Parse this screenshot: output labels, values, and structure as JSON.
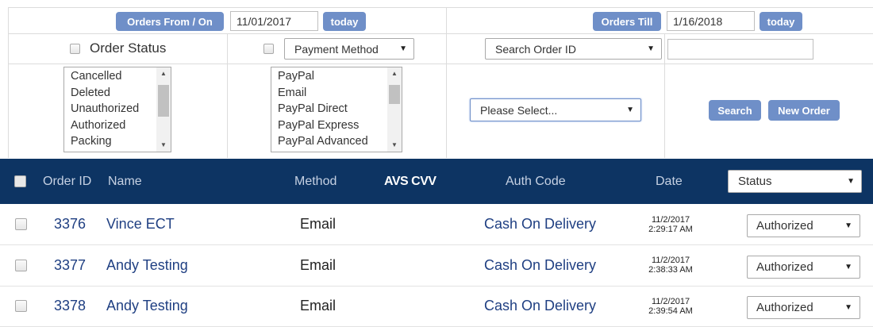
{
  "filters": {
    "orders_from_label": "Orders From / On",
    "from_date": "11/01/2017",
    "today_label": "today",
    "orders_till_label": "Orders Till",
    "till_date": "1/16/2018",
    "order_status_label": "Order Status",
    "payment_method_select": "Payment Method",
    "search_order_select": "Search Order ID",
    "search_order_value": "",
    "status_list": [
      "Cancelled",
      "Deleted",
      "Unauthorized",
      "Authorized",
      "Packing"
    ],
    "payment_list": [
      "PayPal",
      "Email",
      "PayPal Direct",
      "PayPal Express",
      "PayPal Advanced"
    ],
    "please_select": "Please Select...",
    "search_button": "Search",
    "new_order_button": "New Order"
  },
  "table": {
    "headers": {
      "order_id": "Order ID",
      "name": "Name",
      "method": "Method",
      "avs_cvv": "AVS CVV",
      "auth_code": "Auth Code",
      "date": "Date",
      "status_select": "Status"
    },
    "rows": [
      {
        "id": "3376",
        "name": "Vince ECT",
        "method": "Email",
        "auth_code": "Cash On Delivery",
        "date_line1": "11/2/2017",
        "date_line2": "2:29:17 AM",
        "status": "Authorized"
      },
      {
        "id": "3377",
        "name": "Andy Testing",
        "method": "Email",
        "auth_code": "Cash On Delivery",
        "date_line1": "11/2/2017",
        "date_line2": "2:38:33 AM",
        "status": "Authorized"
      },
      {
        "id": "3378",
        "name": "Andy Testing",
        "method": "Email",
        "auth_code": "Cash On Delivery",
        "date_line1": "11/2/2017",
        "date_line2": "2:39:54 AM",
        "status": "Authorized"
      }
    ]
  },
  "colors": {
    "header_bg": "#0d3463",
    "button_bg": "#6f8fc8",
    "link_text": "#1f3f82"
  }
}
